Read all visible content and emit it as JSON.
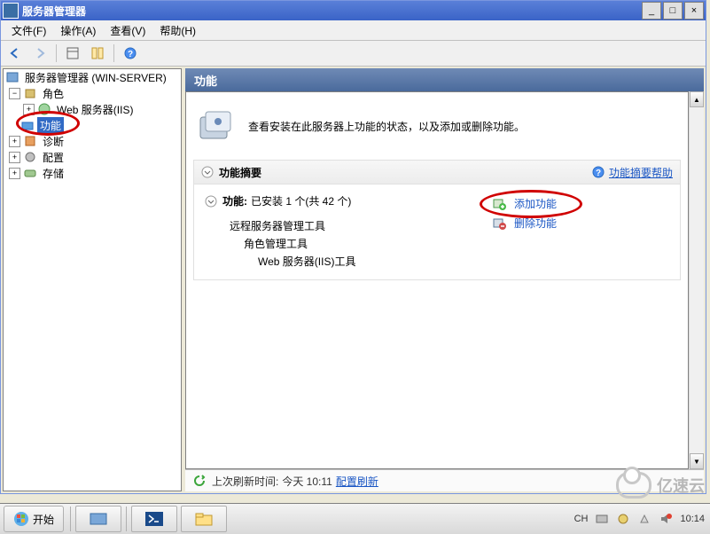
{
  "window": {
    "title": "服务器管理器",
    "buttons": {
      "min": "_",
      "max": "□",
      "close": "×"
    }
  },
  "menu": {
    "file": "文件(F)",
    "action": "操作(A)",
    "view": "查看(V)",
    "help": "帮助(H)"
  },
  "tree": {
    "root": "服务器管理器 (WIN-SERVER)",
    "roles": "角色",
    "iis": "Web 服务器(IIS)",
    "features": "功能",
    "diagnostics": "诊断",
    "configuration": "配置",
    "storage": "存储"
  },
  "content": {
    "heading": "功能",
    "intro": "查看安装在此服务器上功能的状态，以及添加或删除功能。",
    "summary_title": "功能摘要",
    "summary_help": "功能摘要帮助",
    "features_label": "功能:",
    "features_status": "已安装 1 个(共 42 个)",
    "installed": {
      "tool1": "远程服务器管理工具",
      "tool2": "角色管理工具",
      "tool3": "Web 服务器(IIS)工具"
    },
    "add_link": "添加功能",
    "remove_link": "删除功能",
    "last_refresh_label": "上次刷新时间:",
    "last_refresh_value": "今天 10:11",
    "refresh_link": "配置刷新"
  },
  "taskbar": {
    "start": "开始",
    "ime": "CH",
    "time": "10:14"
  },
  "watermark": "亿速云"
}
